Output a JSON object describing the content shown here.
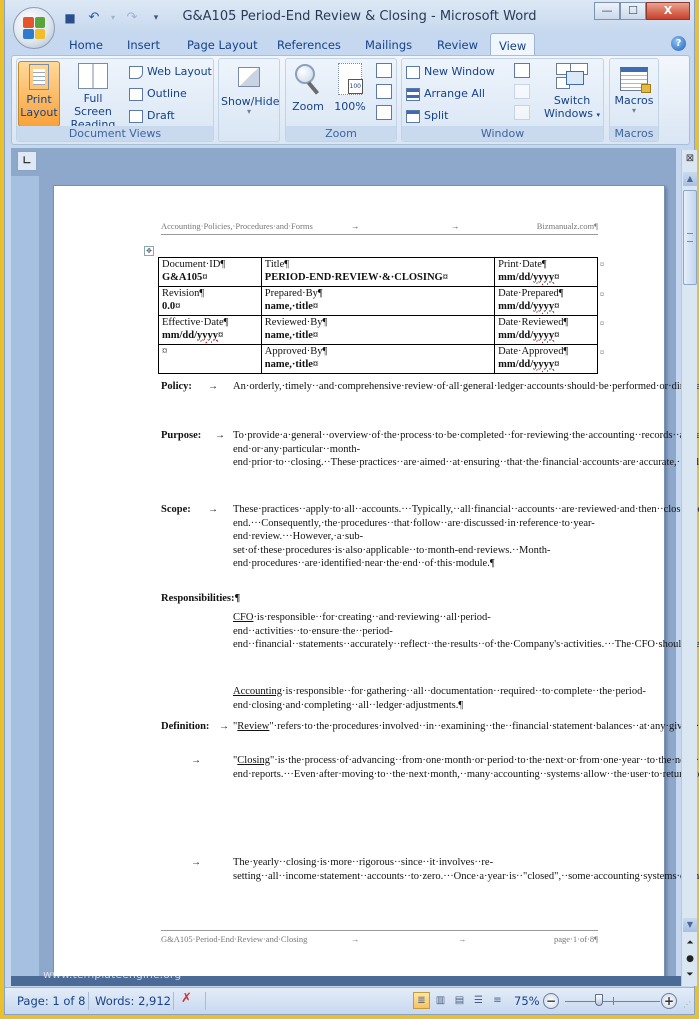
{
  "window": {
    "title": "G&A105 Period-End Review & Closing - Microsoft Word",
    "controls": {
      "minimize": "—",
      "maximize": "☐",
      "close": "X"
    }
  },
  "quick_access": [
    {
      "name": "save-icon",
      "glyph": "💾"
    },
    {
      "name": "undo-icon",
      "glyph": "↶"
    },
    {
      "name": "redo-icon",
      "glyph": "↷"
    },
    {
      "name": "customize-icon",
      "glyph": "▾"
    }
  ],
  "tabs": [
    "Home",
    "Insert",
    "Page Layout",
    "References",
    "Mailings",
    "Review",
    "View"
  ],
  "active_tab": "View",
  "ribbon": {
    "document_views": {
      "label": "Document Views",
      "print_layout": "Print Layout",
      "print_layout_l1": "Print",
      "print_layout_l2": "Layout",
      "full_screen_l1": "Full Screen",
      "full_screen_l2": "Reading",
      "web_layout": "Web Layout",
      "outline": "Outline",
      "draft": "Draft"
    },
    "show_hide": {
      "label": "Show/Hide"
    },
    "zoom": {
      "label": "Zoom",
      "zoom_btn": "Zoom",
      "hundred": "100%"
    },
    "window": {
      "label": "Window",
      "new_window": "New Window",
      "arrange_all": "Arrange All",
      "split": "Split",
      "switch_l1": "Switch",
      "switch_l2": "Windows"
    },
    "macros": {
      "label": "Macros",
      "btn": "Macros"
    }
  },
  "document": {
    "header": {
      "left": "Accounting·Policies,·Procedures·and·Forms",
      "arrow": "→",
      "right": "Bizmanualz.com¶"
    },
    "table": [
      [
        {
          "l": "Document·ID¶",
          "v": "G&A105¤"
        },
        {
          "l": "Title¶",
          "v": "PERIOD-END·REVIEW·&·CLOSING¤"
        },
        {
          "l": "Print·Date¶",
          "v": "mm/dd/yyyy¤"
        }
      ],
      [
        {
          "l": "Revision¶",
          "v": "0.0¤"
        },
        {
          "l": "Prepared·By¶",
          "v": "name,·title¤"
        },
        {
          "l": "Date·Prepared¶",
          "v": "mm/dd/yyyy¤"
        }
      ],
      [
        {
          "l": "Effective·Date¶",
          "v": "mm/dd/yyyy¤"
        },
        {
          "l": "Reviewed·By¶",
          "v": "name,·title¤"
        },
        {
          "l": "Date·Reviewed¶",
          "v": "mm/dd/yyyy¤"
        }
      ],
      [
        {
          "l": "¤",
          "v": ""
        },
        {
          "l": "Approved·By¶",
          "v": "name,·title¤"
        },
        {
          "l": "Date·Approved¶",
          "v": "mm/dd/yyyy¤"
        }
      ]
    ],
    "end_mark": "¤",
    "policy": {
      "label": "Policy:",
      "text": "An·orderly,·timely··and·comprehensive·review·of·all·general·ledger·accounts·should·be·performed·or·directed··by·the·CFO·to·ensure·an·accurate·representation··of·the·company's·financial··statements.···¶"
    },
    "purpose": {
      "label": "Purpose:",
      "text": "To·provide·a·general··overview·of·the·process·to·be·completed··for·reviewing·the·accounting··records··at·year-end·or·any·particular··month-end·prior·to··closing.··These·practices··are·aimed··at·ensuring··that·the·financial·accounts·are·accurate,··and·if·not,··are·properly··adjusted·to·make·them·accurate,·prior·to··closing.··¶"
    },
    "scope": {
      "label": "Scope:",
      "text": "These·practices··apply·to·all··accounts.···Typically,··all·financial··accounts··are·reviewed·and·then··closed··out·as·of·the·company's·year-end.···Consequently,·the·procedures··that·follow··are·discussed·in·reference·to·year-end·review.···However,·a·sub-set·of·these·procedures·is·also·applicable··to·month-end·reviews.··Month-end·procedures··are·identified·near·the·end··of·this·module.¶"
    },
    "responsibilities": {
      "label": "Responsibilities:¶",
      "cfo_term": "CFO",
      "cfo_text": "·is·responsible··for·creating··and·reviewing··all·period-end··activities··to·ensure·the··period-end··financial··statements··accurately··reflect··the·results··of·the·Company's·activities.···The·CFO·should·be·familiar··with·the·specific·software·procedures··for·keeping··the·prior·year··open·until··all··final·closing·adjustments·have·been··made··and·approved··by·the·CFO.¶",
      "acct_term": "Accounting",
      "acct_text": "·is·responsible··for·gathering··all··documentation··required··to·complete··the·period-end·closing·and·completing··all··ledger·adjustments.¶"
    },
    "definition": {
      "label": "Definition:",
      "review_term": "Review",
      "review_text": "\"·refers·to·the·procedures·involved··in··examining··the··financial·statement·balances··at·any·given··period··to·ascertain··their·accuracy.¶",
      "closing_term": "Closing",
      "closing_text": "\"·is·the·process·of·advancing··from·one·month·or·period·to·the·next·or·from·one·year··to·the·next.···In·most·computerized··accounting·systems·the·periods··are·closed·by·executing··a·menu·command.···Monthly·closings·usually··involve··nothing··more·than··entering··the·next·month·and·responding·to··the·program's··suggestion·to·print··various·month-end·reports.···Even·after·moving·to··the·next·month,··many·accounting··systems·allow··the·user·to·return··to·previous··months·to·enter··or·edit·transactions.···¶",
      "yearly_text": "The·yearly··closing·is·more··rigorous··since··it·involves··re-setting··all··income·statement··accounts··to·zero.···Once·a·year·is··\"closed\",··some·accounting·systems·do·not·allow··the·user·to·go·back··or·open·a·closed·period··to·make·"
    },
    "footer": {
      "left": "G&A105·Period-End·Review·and·Closing",
      "arrow": "→",
      "right": "page·1·of·8¶"
    }
  },
  "watermark": "www.templateengine.org",
  "statusbar": {
    "page": "Page: 1 of 8",
    "words": "Words: 2,912",
    "zoom": "75%",
    "zoom_level_percent": 75
  }
}
